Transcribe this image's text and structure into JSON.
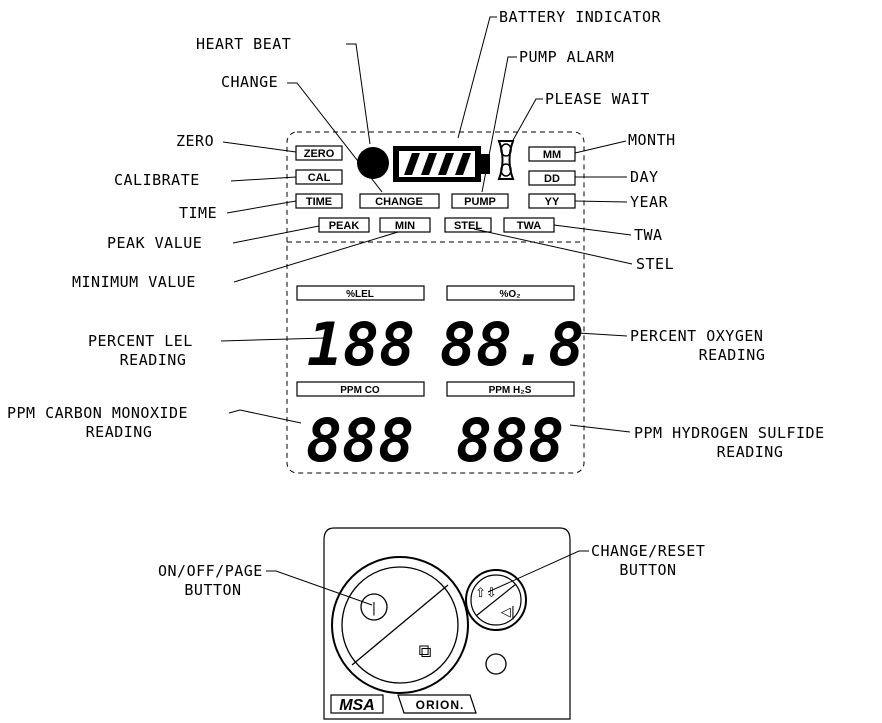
{
  "callouts": {
    "battery_indicator": "BATTERY INDICATOR",
    "heart_beat": "HEART BEAT",
    "pump_alarm": "PUMP ALARM",
    "change": "CHANGE",
    "please_wait": "PLEASE WAIT",
    "zero": "ZERO",
    "month": "MONTH",
    "calibrate": "CALIBRATE",
    "day": "DAY",
    "time": "TIME",
    "year": "YEAR",
    "peak_value": "PEAK VALUE",
    "twa": "TWA",
    "minimum_value": "MINIMUM VALUE",
    "stel": "STEL",
    "percent_lel_1": "PERCENT LEL",
    "percent_lel_2": "READING",
    "percent_oxygen_1": "PERCENT OXYGEN",
    "percent_oxygen_2": "READING",
    "ppm_co_1": "PPM CARBON MONOXIDE",
    "ppm_co_2": "READING",
    "ppm_h2s_1": "PPM HYDROGEN SULFIDE",
    "ppm_h2s_2": "READING",
    "onoff_button_1": "ON/OFF/PAGE",
    "onoff_button_2": "BUTTON",
    "change_reset_1": "CHANGE/RESET",
    "change_reset_2": "BUTTON"
  },
  "display": {
    "zero_tag": "ZERO",
    "cal_tag": "CAL",
    "time_tag": "TIME",
    "change_tag": "CHANGE",
    "pump_tag": "PUMP",
    "mm_tag": "MM",
    "dd_tag": "DD",
    "yy_tag": "YY",
    "peak_tag": "PEAK",
    "min_tag": "MIN",
    "stel_tag": "STEL",
    "twa_tag": "TWA",
    "lel_header": "%LEL",
    "o2_header": "%O₂",
    "co_header": "PPM CO",
    "h2s_header": "PPM H₂S",
    "lel_digits": "188",
    "o2_digits": "88.8",
    "co_digits": "888",
    "h2s_digits": "888"
  },
  "device": {
    "power_symbol": "|",
    "page_symbol": "⧉",
    "arrows_symbol": "⇧⇩",
    "mute_symbol": "◁|",
    "brand_msa": "MSA",
    "brand_orion": "ORION."
  },
  "icons": {
    "heartbeat": "filled-circle-icon",
    "battery": "battery-icon",
    "please_wait": "hourglass-icon"
  }
}
